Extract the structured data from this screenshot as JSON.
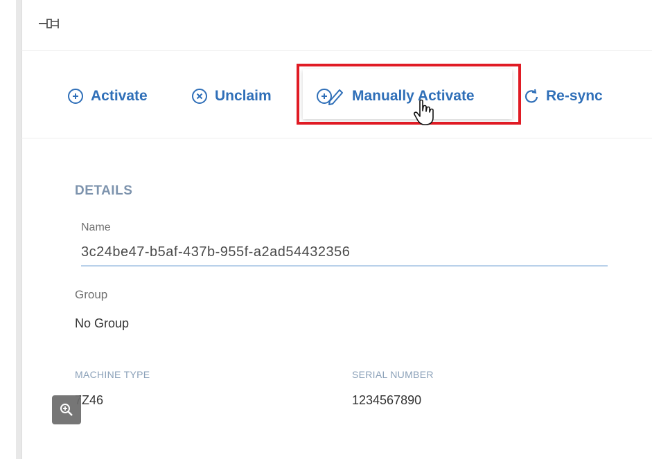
{
  "toolbar": {
    "pin_icon": "pin-icon",
    "actions": [
      {
        "label": "Activate",
        "icon": "plus-circle-icon"
      },
      {
        "label": "Unclaim",
        "icon": "x-circle-icon"
      },
      {
        "label": "Manually Activate",
        "icon": "plus-pencil-icon"
      },
      {
        "label": "Re-sync",
        "icon": "refresh-icon"
      }
    ]
  },
  "highlight": {
    "color": "#e01b24"
  },
  "accent_color": "#2f6fb8",
  "details": {
    "section_title": "DETAILS",
    "name_label": "Name",
    "name_value": "3c24be47-b5af-437b-955f-a2ad54432356",
    "group_label": "Group",
    "group_value": "No Group",
    "machine_type_label": "MACHINE TYPE",
    "machine_type_value": "7Z46",
    "serial_number_label": "SERIAL NUMBER",
    "serial_number_value": "1234567890"
  },
  "overlay": {
    "zoom_icon": "zoom-in-icon"
  }
}
